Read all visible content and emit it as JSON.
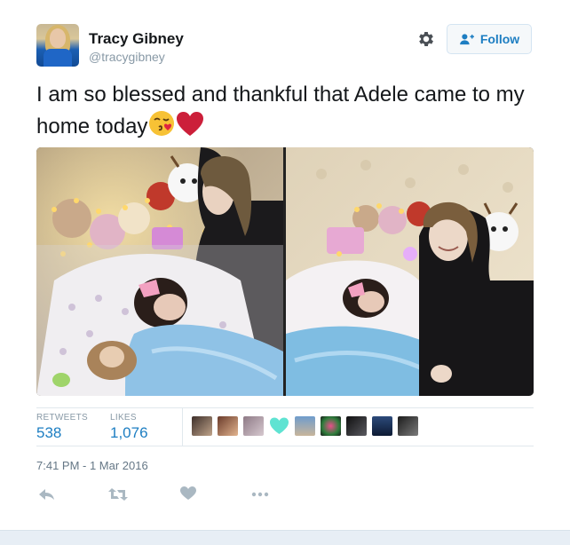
{
  "user": {
    "name": "Tracy Gibney",
    "handle": "@tracygibney"
  },
  "follow_button": {
    "label": "Follow"
  },
  "tweet": {
    "text": "I am so blessed and thankful that Adele came to my home today",
    "emojis": [
      "kissing-face-emoji",
      "red-heart-emoji"
    ]
  },
  "stats": {
    "retweets_label": "RETWEETS",
    "retweets_value": "538",
    "likes_label": "LIKES",
    "likes_value": "1,076"
  },
  "likers": [
    "liker-avatar",
    "liker-avatar",
    "liker-avatar",
    "heart-icon",
    "liker-avatar",
    "liker-avatar",
    "liker-avatar",
    "liker-avatar",
    "liker-avatar"
  ],
  "timestamp": "7:41 PM - 1 Mar 2016",
  "actions": [
    "reply-icon",
    "retweet-icon",
    "like-icon",
    "more-icon"
  ],
  "colors": {
    "accent": "#1d7ec2",
    "heart": "#cc1f3a",
    "muted": "#8899a6"
  }
}
